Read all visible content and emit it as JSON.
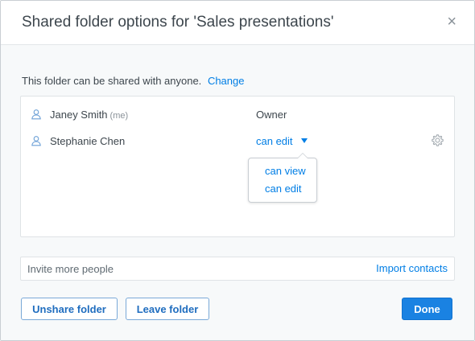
{
  "dialog": {
    "title": "Shared folder options for 'Sales presentations'",
    "close_glyph": "×"
  },
  "share_info": {
    "text": "This folder can be shared with anyone.",
    "change_link": "Change"
  },
  "members": [
    {
      "name": "Janey Smith",
      "tag": "(me)",
      "role": "Owner",
      "icon": "person-icon"
    },
    {
      "name": "Stephanie Chen",
      "role": "can edit",
      "icon": "person-icon",
      "settings_icon": "gear-icon"
    }
  ],
  "role_menu": {
    "options": [
      "can view",
      "can edit"
    ]
  },
  "invite": {
    "placeholder": "Invite more people",
    "import_link": "Import contacts"
  },
  "buttons": {
    "unshare": "Unshare folder",
    "leave": "Leave folder",
    "done": "Done"
  },
  "colors": {
    "accent": "#007ee5",
    "primary_button": "#1a82e2",
    "text": "#3d464d"
  }
}
